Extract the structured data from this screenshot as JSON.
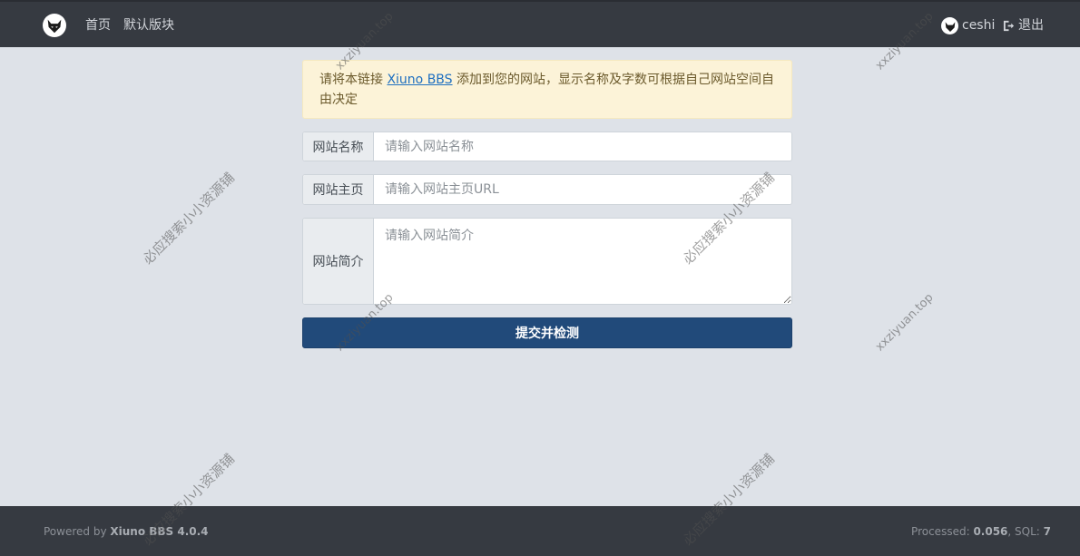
{
  "header": {
    "home_label": "首页",
    "forum_label": "默认版块",
    "username": "ceshi",
    "logout_label": "退出"
  },
  "alert": {
    "text_before": "请将本链接 ",
    "link_text": "Xiuno BBS",
    "text_after": " 添加到您的网站，显示名称及字数可根据自己网站空间自由决定"
  },
  "form": {
    "name_label": "网站名称",
    "name_placeholder": "请输入网站名称",
    "url_label": "网站主页",
    "url_placeholder": "请输入网站主页URL",
    "desc_label": "网站简介",
    "desc_placeholder": "请输入网站简介",
    "submit_label": "提交并检测"
  },
  "footer": {
    "powered_prefix": "Powered by ",
    "powered_name": "Xiuno BBS 4.0.4",
    "processed_label": "Processed: ",
    "processed_value": "0.056",
    "sql_label": ", SQL: ",
    "sql_value": "7"
  },
  "watermarks": {
    "cn": "必应搜索小小资源铺",
    "en": "xxziyuan.top"
  },
  "colors": {
    "navbar": "#363a41",
    "background": "#dee2e8",
    "alert_bg": "#fcf3d8",
    "primary_button": "#214a7a",
    "link": "#1e6fc0"
  }
}
